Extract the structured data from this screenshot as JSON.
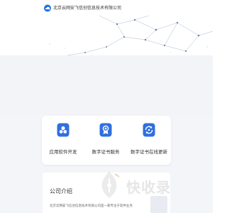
{
  "header": {
    "company_name": "北京云网安飞信创信息技术有限公司",
    "logo_icon": "cloud-logo-icon"
  },
  "colors": {
    "accent": "#2f6fe0",
    "banner_line": "#9fb2c8"
  },
  "services": [
    {
      "label": "应用软件开发",
      "icon": "app-development-icon"
    },
    {
      "label": "数字证书服务",
      "icon": "certificate-service-icon"
    },
    {
      "label": "数字证书在线更新",
      "icon": "certificate-update-icon"
    }
  ],
  "about": {
    "title": "公司介绍",
    "text": "北京云网安飞信创信息技术有限公司是一家专注于软件业务"
  },
  "watermark": {
    "text": "快收录",
    "icon": "pen-logo-icon"
  }
}
